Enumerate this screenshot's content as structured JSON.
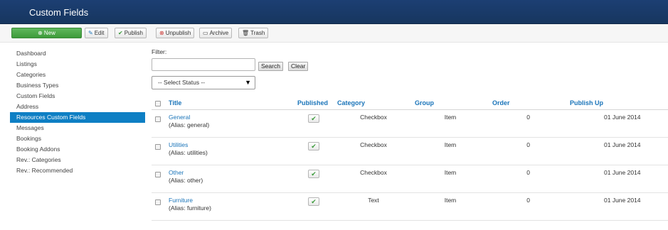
{
  "header": {
    "title": "Custom Fields"
  },
  "toolbar": {
    "new": "New",
    "edit": "Edit",
    "publish": "Publish",
    "unpublish": "Unpublish",
    "archive": "Archive",
    "trash": "Trash"
  },
  "sidebar": {
    "items": [
      {
        "label": "Dashboard",
        "active": false
      },
      {
        "label": "Listings",
        "active": false
      },
      {
        "label": "Categories",
        "active": false
      },
      {
        "label": "Business Types",
        "active": false
      },
      {
        "label": "Custom Fields",
        "active": false
      },
      {
        "label": "Address",
        "active": false
      },
      {
        "label": "Resources Custom Fields",
        "active": true
      },
      {
        "label": "Messages",
        "active": false
      },
      {
        "label": "Bookings",
        "active": false
      },
      {
        "label": "Booking Addons",
        "active": false
      },
      {
        "label": "Rev.: Categories",
        "active": false
      },
      {
        "label": "Rev.: Recommended",
        "active": false
      }
    ]
  },
  "filter": {
    "label": "Filter:",
    "value": "",
    "search_label": "Search",
    "clear_label": "Clear",
    "status_selected": "-- Select Status --"
  },
  "table": {
    "headers": {
      "title": "Title",
      "published": "Published",
      "category": "Category",
      "group": "Group",
      "order": "Order",
      "publish_up": "Publish Up"
    },
    "rows": [
      {
        "title": "General",
        "alias": "(Alias: general)",
        "published": true,
        "category": "Checkbox",
        "group": "Item",
        "order": "0",
        "publish_up": "01 June 2014"
      },
      {
        "title": "Utilities",
        "alias": "(Alias: utilities)",
        "published": true,
        "category": "Checkbox",
        "group": "Item",
        "order": "0",
        "publish_up": "01 June 2014"
      },
      {
        "title": "Other",
        "alias": "(Alias: other)",
        "published": true,
        "category": "Checkbox",
        "group": "Item",
        "order": "0",
        "publish_up": "01 June 2014"
      },
      {
        "title": "Furniture",
        "alias": "(Alias: furniture)",
        "published": true,
        "category": "Text",
        "group": "Item",
        "order": "0",
        "publish_up": "01 June 2014"
      }
    ]
  },
  "colors": {
    "header_bg": "#1c3f73",
    "accent": "#0e7fc4",
    "link": "#1a74b9",
    "new_button": "#4caf50",
    "check": "#3a9a3a"
  }
}
